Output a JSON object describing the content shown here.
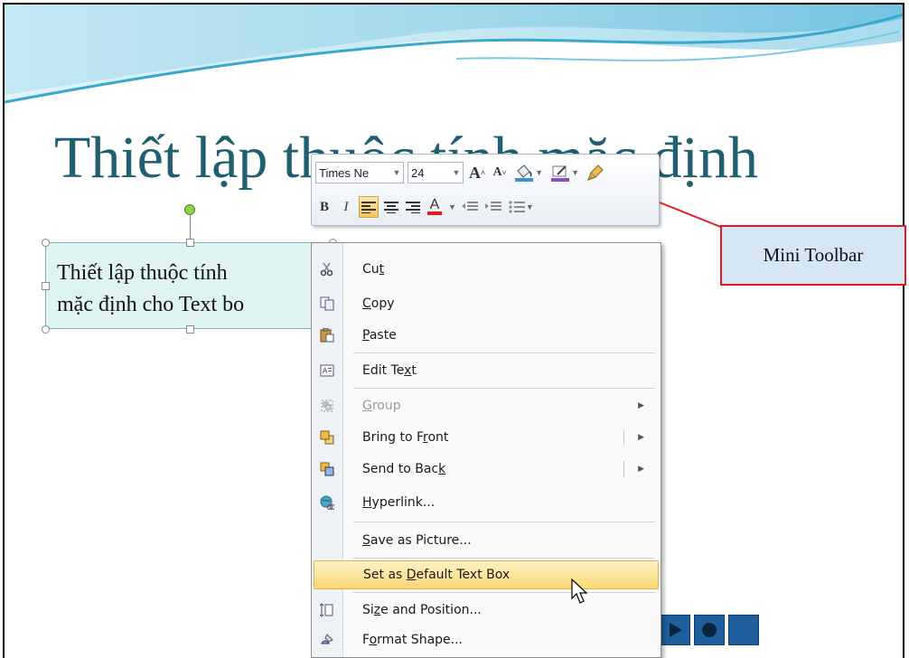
{
  "slide": {
    "title": "Thiết lập thuộc tính mặc định",
    "textbox_line1": "Thiết lập thuộc tính",
    "textbox_line2": "mặc định cho Text bo"
  },
  "mini_toolbar": {
    "font_name": "Times Ne",
    "font_size": "24",
    "grow_font": "A",
    "shrink_font": "A",
    "bold": "B",
    "italic": "I",
    "font_color_label": "A"
  },
  "context_menu": {
    "items": [
      {
        "pre": "Cu",
        "key": "t",
        "post": "",
        "icon": "scissors-icon"
      },
      {
        "pre": "",
        "key": "C",
        "post": "opy",
        "icon": "copy-icon"
      },
      {
        "pre": "",
        "key": "P",
        "post": "aste",
        "icon": "paste-icon"
      },
      {
        "pre": "Edit Te",
        "key": "x",
        "post": "t",
        "icon": "edit-text-icon"
      },
      {
        "pre": "",
        "key": "G",
        "post": "roup",
        "icon": "group-icon",
        "disabled": true
      },
      {
        "pre": "Bring to F",
        "key": "r",
        "post": "ont",
        "icon": "bring-front-icon"
      },
      {
        "pre": "Send to Bac",
        "key": "k",
        "post": "",
        "icon": "send-back-icon"
      },
      {
        "pre": "",
        "key": "H",
        "post": "yperlink...",
        "icon": "hyperlink-icon"
      },
      {
        "pre": "",
        "key": "S",
        "post": "ave as Picture...",
        "icon": ""
      },
      {
        "pre": "Set as ",
        "key": "D",
        "post": "efault Text Box",
        "icon": ""
      },
      {
        "pre": "Si",
        "key": "z",
        "post": "e and Position...",
        "icon": "size-position-icon"
      },
      {
        "pre": "F",
        "key": "o",
        "post": "rmat Shape...",
        "icon": "format-shape-icon"
      }
    ]
  },
  "callout": {
    "label": "Mini Toolbar",
    "border_color": "#e11b22"
  },
  "colors": {
    "title": "#1f5f6f",
    "highlight": "#fbd776",
    "nav": "#1f5f9d"
  }
}
